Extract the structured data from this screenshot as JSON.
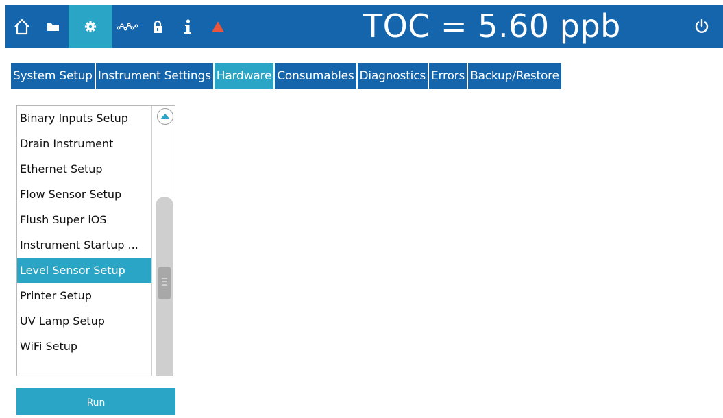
{
  "toolbar": {
    "icons": [
      "home-icon",
      "folder-icon",
      "gear-icon",
      "trend-icon",
      "lock-icon",
      "info-icon",
      "warning-icon"
    ],
    "active_icon": "gear-icon",
    "toc_reading": "TOC = 5.60 ppb",
    "power_icon": "power-icon"
  },
  "tabs": [
    {
      "label": "System Setup",
      "active": false
    },
    {
      "label": "Instrument Settings",
      "active": false
    },
    {
      "label": "Hardware",
      "active": true
    },
    {
      "label": "Consumables",
      "active": false
    },
    {
      "label": "Diagnostics",
      "active": false
    },
    {
      "label": "Errors",
      "active": false
    },
    {
      "label": "Backup/Restore",
      "active": false
    }
  ],
  "hardware_list": {
    "items": [
      "Binary Inputs Setup",
      "Drain Instrument",
      "Ethernet Setup",
      "Flow Sensor Setup",
      "Flush Super iOS",
      "Instrument Startup ...",
      "Level Sensor Setup",
      "Printer Setup",
      "UV Lamp Setup",
      "WiFi Setup"
    ],
    "selected": "Level Sensor Setup"
  },
  "run_button": {
    "label": "Run"
  },
  "colors": {
    "bar_blue": "#1565ad",
    "active_cyan": "#2aa5c6",
    "warning_orange": "#e8553a"
  }
}
